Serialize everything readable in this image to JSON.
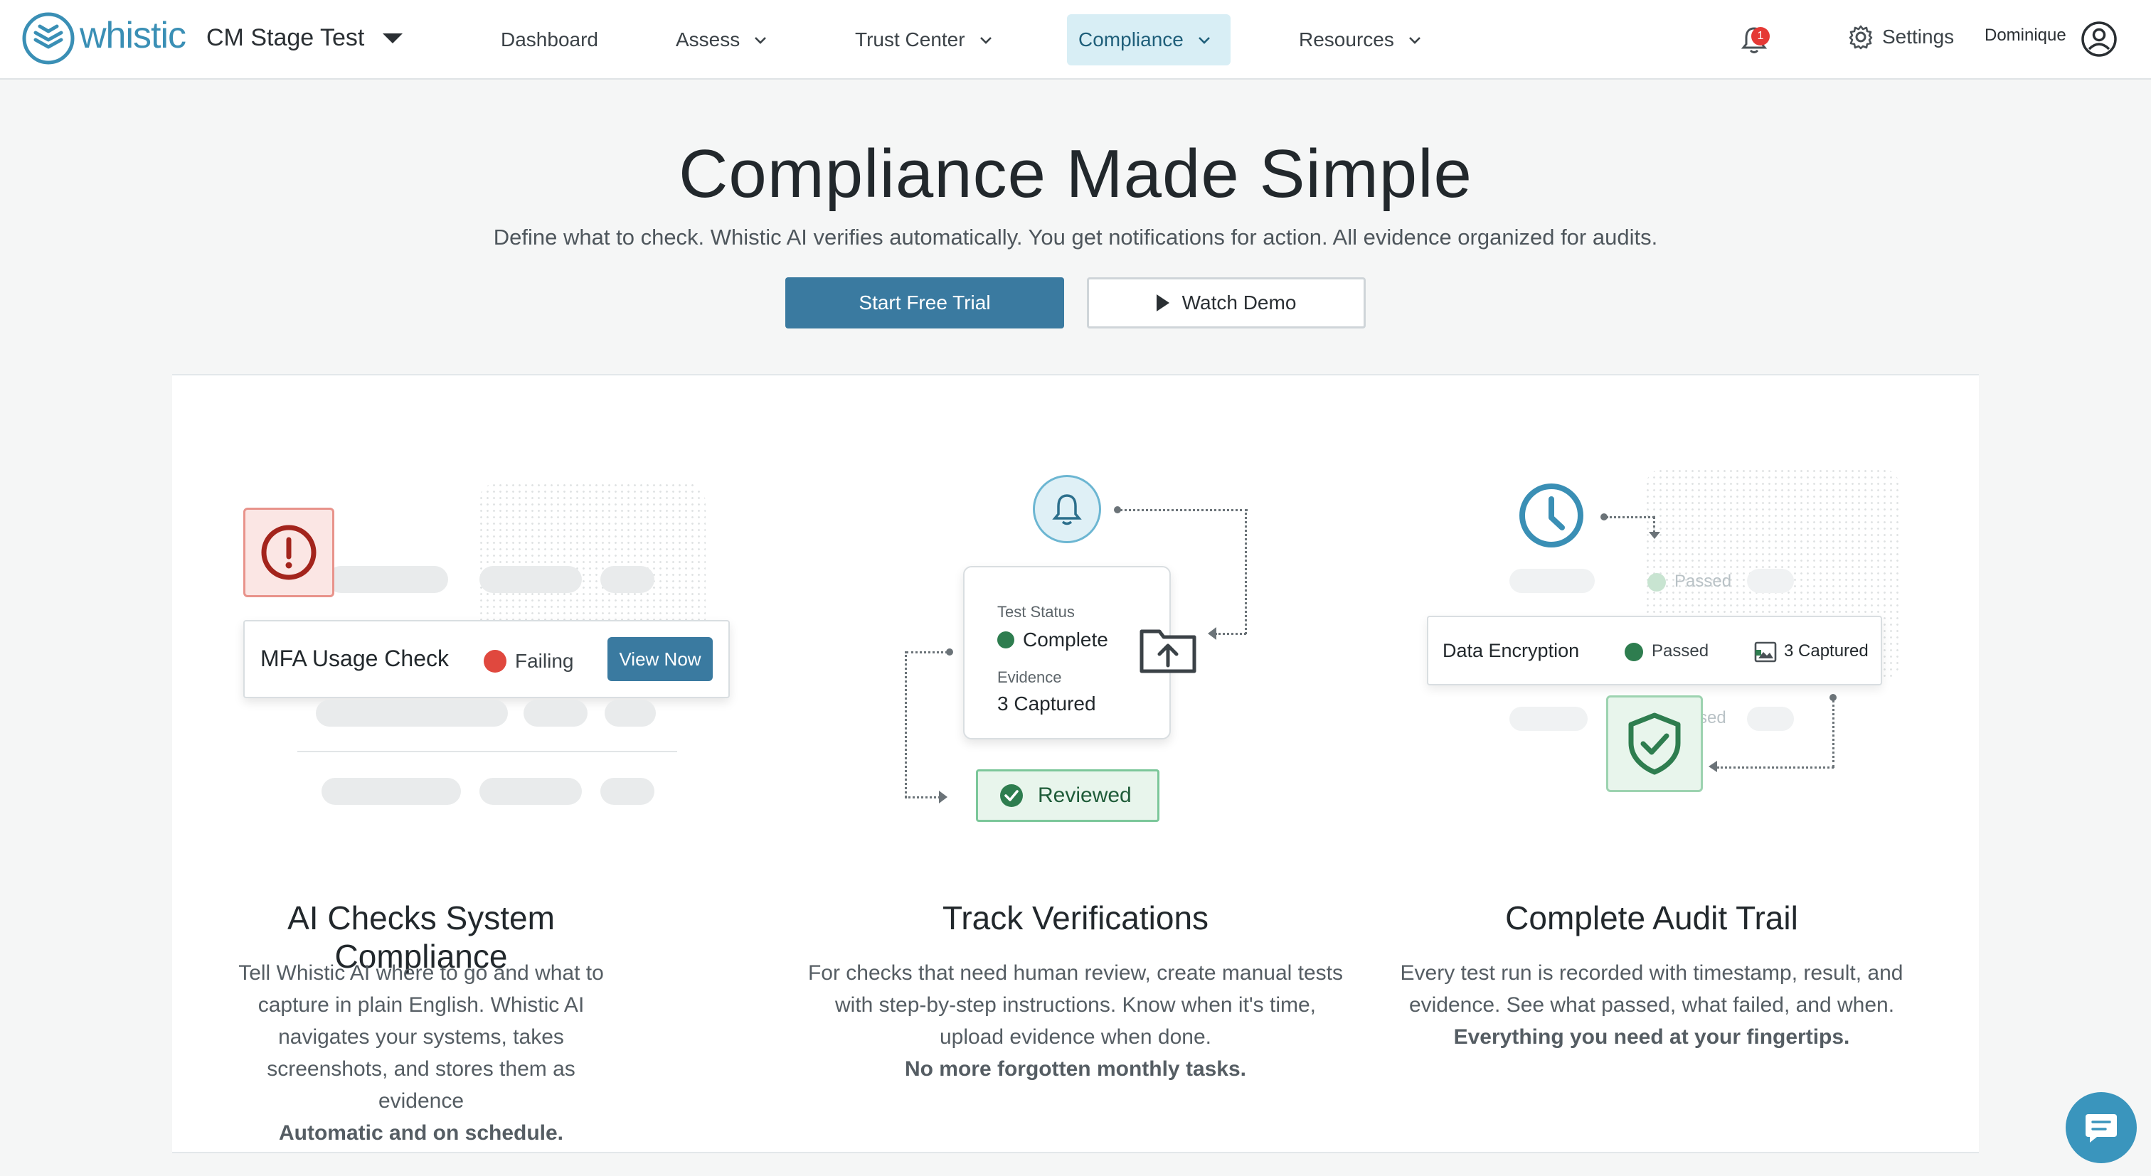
{
  "nav": {
    "logo_text": "whistic",
    "workspace": "CM Stage Test",
    "menu": [
      {
        "label": "Dashboard"
      },
      {
        "label": "Assess"
      },
      {
        "label": "Trust Center"
      },
      {
        "label": "Compliance"
      },
      {
        "label": "Resources"
      }
    ],
    "active_menu": "Compliance",
    "notification_count": "1",
    "settings_label": "Settings",
    "user_name": "Dominique"
  },
  "hero": {
    "title": "Compliance Made Simple",
    "subtitle": "Define what to check. Whistic AI verifies automatically. You get notifications for action. All evidence organized for audits.",
    "primary_cta": "Start Free Trial",
    "secondary_cta": "Watch Demo"
  },
  "features": [
    {
      "title": "AI Checks System Compliance",
      "description": "Tell Whistic AI where to go and what to capture in plain English. Whistic AI navigates your systems, takes screenshots, and stores them as evidence",
      "emphasis": "Automatic and on schedule.",
      "illustration": {
        "check_name": "MFA Usage Check",
        "status": "Failing",
        "status_color": "#e0483e",
        "action": "View Now"
      }
    },
    {
      "title": "Track Verifications",
      "description": "For checks that need human review, create manual tests with step-by-step instructions. Know when it's time, upload evidence when done.",
      "emphasis": "No more forgotten monthly tasks.",
      "illustration": {
        "status_label": "Test Status",
        "status_value": "Complete",
        "evidence_label": "Evidence",
        "evidence_value": "3 Captured",
        "reviewed_label": "Reviewed",
        "status_color": "#2e7d4f"
      }
    },
    {
      "title": "Complete Audit Trail",
      "description": "Every test run is recorded with timestamp, result, and evidence. See what passed, what failed, and when.",
      "emphasis": "Everything you need at your fingertips.",
      "illustration": {
        "row_name": "Data Encryption",
        "status": "Passed",
        "captured": "3 Captured",
        "ghost_status_1": "Passed",
        "ghost_status_2": "sed",
        "status_color": "#2e7d4f"
      }
    }
  ],
  "colors": {
    "brand": "#3a8fb5",
    "primary_button": "#3a7aa0",
    "active_nav_bg": "#d8eef5"
  }
}
